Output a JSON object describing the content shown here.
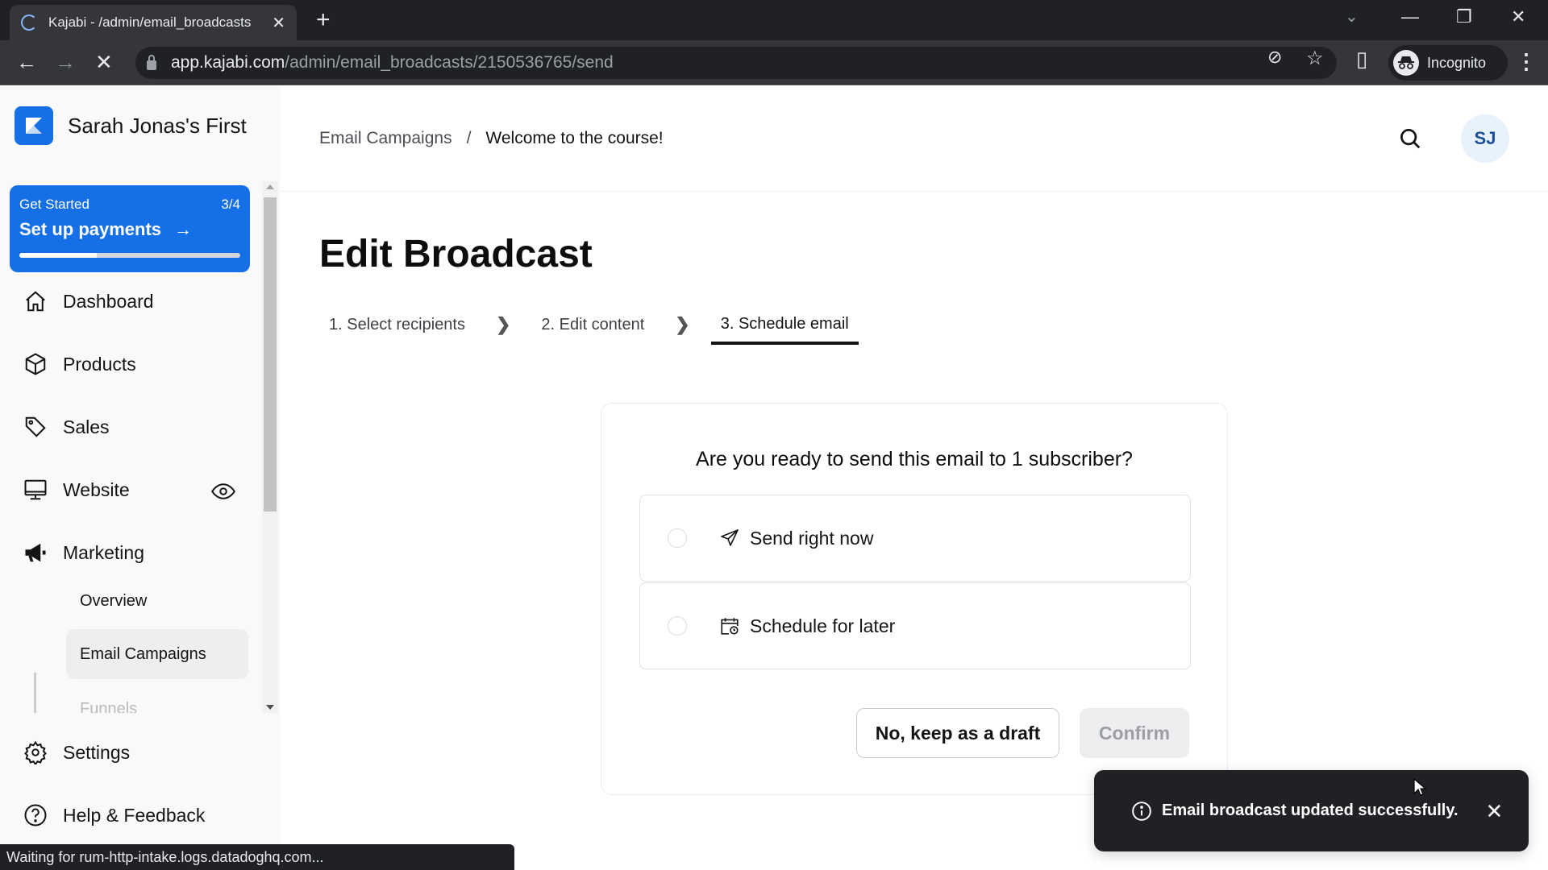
{
  "browser": {
    "tab_title": "Kajabi - /admin/email_broadcasts",
    "tab_close": "✕",
    "new_tab": "+",
    "url_host": "app.kajabi.com",
    "url_path": "/admin/email_broadcasts/2150536765/send",
    "incognito_label": "Incognito",
    "status_text": "Waiting for rum-http-intake.logs.datadoghq.com...",
    "icons": {
      "back": "←",
      "forward": "→",
      "stop": "✕",
      "tab_search": "⌄",
      "minimize": "—",
      "restore": "❐",
      "close": "✕",
      "eye_off": "⊘",
      "star": "☆",
      "sidebar": "▯",
      "menu": "⋮"
    }
  },
  "sidebar": {
    "site_name": "Sarah Jonas's First",
    "get_started": {
      "label": "Get Started",
      "count": "3/4",
      "title": "Set up payments",
      "arrow": "→",
      "progress_fraction": 0.35
    },
    "nav": [
      {
        "label": "Dashboard",
        "icon": "home-icon"
      },
      {
        "label": "Products",
        "icon": "box-icon"
      },
      {
        "label": "Sales",
        "icon": "tag-icon"
      },
      {
        "label": "Website",
        "icon": "monitor-icon"
      },
      {
        "label": "Marketing",
        "icon": "megaphone-icon"
      }
    ],
    "marketing_sub": [
      {
        "label": "Overview",
        "active": false
      },
      {
        "label": "Email Campaigns",
        "active": true
      },
      {
        "label": "Funnels",
        "active": false
      }
    ],
    "footer_nav": [
      {
        "label": "Settings",
        "icon": "gear-icon"
      },
      {
        "label": "Help & Feedback",
        "icon": "help-icon"
      }
    ]
  },
  "header": {
    "breadcrumb": {
      "parent": "Email Campaigns",
      "separator": "/",
      "current": "Welcome to the course!"
    },
    "avatar_initials": "SJ"
  },
  "main": {
    "title": "Edit Broadcast",
    "steps": [
      {
        "label": "1. Select recipients",
        "active": false
      },
      {
        "label": "2. Edit content",
        "active": false
      },
      {
        "label": "3. Schedule email",
        "active": true
      }
    ],
    "step_separator": "❯",
    "question": "Are you ready to send this email to 1 subscriber?",
    "options": [
      {
        "label": "Send right now",
        "selected": false
      },
      {
        "label": "Schedule for later",
        "selected": false
      }
    ],
    "draft_button": "No, keep as a draft",
    "confirm_button": "Confirm"
  },
  "toast": {
    "message": "Email broadcast updated successfully.",
    "close": "✕"
  }
}
